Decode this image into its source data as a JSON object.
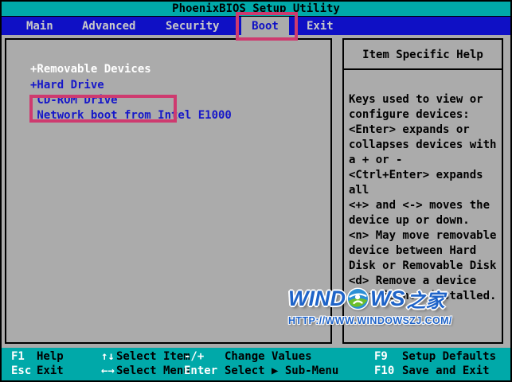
{
  "title": "PhoenixBIOS Setup Utility",
  "menu": {
    "active": "Boot",
    "tabs": [
      {
        "label": "Main"
      },
      {
        "label": "Advanced"
      },
      {
        "label": "Security"
      },
      {
        "label": "Boot"
      },
      {
        "label": "Exit"
      }
    ]
  },
  "boot_list": {
    "items": [
      {
        "label": "+Removable Devices",
        "selected": true
      },
      {
        "label": "+Hard Drive",
        "selected": false
      },
      {
        "label": " CD-ROM Drive",
        "selected": false
      },
      {
        "label": " Network boot from Intel E1000",
        "selected": false
      }
    ]
  },
  "help_panel": {
    "title": "Item Specific Help",
    "lines": [
      "Keys used to view or",
      "configure devices:",
      "<Enter> expands or",
      "collapses devices with",
      "a + or -",
      "<Ctrl+Enter> expands",
      "all",
      "<+> and <-> moves the",
      "device up or down.",
      "<n> May move removable",
      "device between Hard",
      "Disk or Removable Disk",
      "<d> Remove a device",
      "that is not installed."
    ]
  },
  "bottom_bar": {
    "rows": [
      {
        "items": [
          {
            "key": "F1",
            "label": "Help"
          },
          {
            "key": "↑↓",
            "label": "Select Item"
          },
          {
            "key": "-/+",
            "label": "Change Values"
          },
          {
            "key": "F9",
            "label": "Setup Defaults"
          }
        ]
      },
      {
        "items": [
          {
            "key": "Esc",
            "label": "Exit"
          },
          {
            "key": "←→",
            "label": "Select Menu"
          },
          {
            "key": "Enter",
            "label": "Select ▶ Sub-Menu"
          },
          {
            "key": "F10",
            "label": "Save and Exit"
          }
        ]
      }
    ]
  },
  "watermark": {
    "logo_prefix": "WIND",
    "logo_suffix": "WS",
    "logo_cjk": "之家",
    "url": "HTTP://WWW.WINDOWSZJ.COM/"
  },
  "colors": {
    "teal_bar": "#00A9A9",
    "menu_blue": "#0F10C5",
    "panel_grey": "#ABABAB",
    "item_blue": "#1617C9",
    "highlight_pink": "#CE3A6F",
    "watermark_blue": "#1E63C8",
    "selected_item_text": "#FFFFFF"
  }
}
